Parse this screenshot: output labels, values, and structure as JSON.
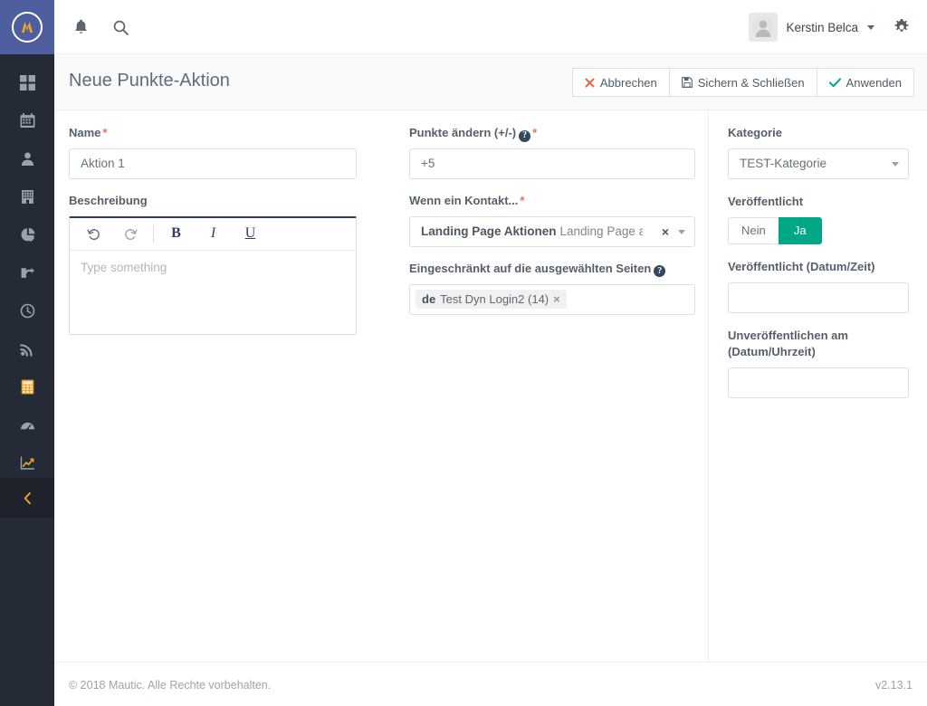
{
  "brand": {
    "logo_name": "mautic-logo"
  },
  "sidebar": {
    "items": [
      {
        "name": "dashboard",
        "icon": "grid-icon",
        "active": false
      },
      {
        "name": "calendar",
        "icon": "calendar-icon",
        "active": false
      },
      {
        "name": "contacts",
        "icon": "person-icon",
        "active": false
      },
      {
        "name": "companies",
        "icon": "building-icon",
        "active": false
      },
      {
        "name": "segments",
        "icon": "pie-chart-icon",
        "active": false
      },
      {
        "name": "points-triggers",
        "icon": "puzzle-icon",
        "active": false
      },
      {
        "name": "campaigns",
        "icon": "clock-icon",
        "active": false
      },
      {
        "name": "channels",
        "icon": "rss-icon",
        "active": false
      },
      {
        "name": "points",
        "icon": "calculator-icon",
        "active": true
      },
      {
        "name": "stages",
        "icon": "speedometer-icon",
        "active": false
      },
      {
        "name": "reports",
        "icon": "chart-line-icon",
        "active": false
      }
    ],
    "collapse_icon": "chevron-left-icon"
  },
  "topbar": {
    "notifications_icon": "bell-icon",
    "search_icon": "search-icon",
    "user": {
      "name": "Kerstin Belca",
      "avatar_icon": "avatar-icon",
      "caret_icon": "chevron-down-icon"
    },
    "settings_icon": "gear-icon"
  },
  "page": {
    "title": "Neue Punkte-Aktion",
    "actions": [
      {
        "label": "Abbrechen",
        "icon": "close-icon",
        "icon_color": "#f4623a"
      },
      {
        "label": "Sichern & Schließen",
        "icon": "save-icon",
        "icon_color": "#55606b"
      },
      {
        "label": "Anwenden",
        "icon": "check-icon",
        "icon_color": "#00a888"
      }
    ]
  },
  "form": {
    "name": {
      "label": "Name",
      "required": true,
      "value": "Aktion 1"
    },
    "description": {
      "label": "Beschreibung",
      "placeholder": "Type something",
      "value": "",
      "toolbar": [
        {
          "name": "undo-icon",
          "label": ""
        },
        {
          "name": "redo-icon",
          "label": ""
        },
        {
          "name": "bold-button",
          "label": "B"
        },
        {
          "name": "italic-button",
          "label": "I"
        },
        {
          "name": "underline-button",
          "label": "U"
        }
      ]
    },
    "points": {
      "label": "Punkte ändern (+/-)",
      "required": true,
      "help": "?",
      "value": "+5"
    },
    "trigger": {
      "label": "Wenn ein Kontakt...",
      "required": true,
      "group": "Landing Page Aktionen",
      "value": "Landing Page aufrr.",
      "clear_icon": "×",
      "caret_icon": "chevron-down-icon"
    },
    "restricted_pages": {
      "label": "Eingeschränkt auf die ausgewählten Seiten",
      "help": "?",
      "tags": [
        {
          "lang": "de",
          "text": "Test Dyn Login2 (14)",
          "remove_icon": "×"
        }
      ]
    }
  },
  "side": {
    "category": {
      "label": "Kategorie",
      "value": "TEST-Kategorie",
      "caret_icon": "chevron-down-icon"
    },
    "published": {
      "label": "Veröffentlicht",
      "options": [
        {
          "label": "Nein",
          "active": false
        },
        {
          "label": "Ja",
          "active": true
        }
      ],
      "active_color": "#00a888"
    },
    "publish_up": {
      "label": "Veröffentlicht (Datum/Zeit)",
      "value": "",
      "placeholder": ""
    },
    "publish_down": {
      "label": "Unveröffentlichen am (Datum/Uhrzeit)",
      "value": "",
      "placeholder": ""
    }
  },
  "footer": {
    "copyright": "© 2018 Mautic. Alle Rechte vorbehalten.",
    "version": "v2.13.1"
  }
}
